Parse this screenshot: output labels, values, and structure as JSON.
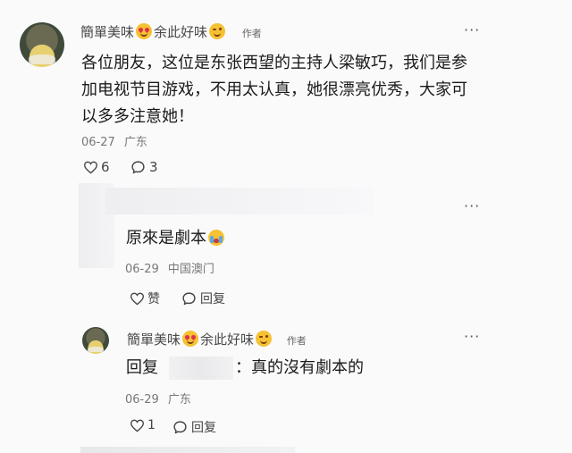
{
  "comment": {
    "username": "簡單美味",
    "username_suffix": "余此好味",
    "author_tag": "作者",
    "more_label": "···",
    "text_line1": "各位朋友，这位是东张西望的主持人梁敏巧，我们是参",
    "text_line2": "加电视节目游戏，不用太认真，她很漂亮优秀，大家可",
    "text_line3": "以多多注意她！",
    "date": "06-27",
    "location": "广东",
    "likes": "6",
    "replies": "3"
  },
  "reply1": {
    "more_label": "···",
    "text": "原來是劇本",
    "date": "06-29",
    "location": "中国澳门",
    "like_label": "赞",
    "reply_label": "回复"
  },
  "reply2": {
    "username": "簡單美味",
    "username_suffix": "余此好味",
    "author_tag": "作者",
    "more_label": "···",
    "reply_prefix": "回复",
    "text": "：真的沒有劇本的",
    "date": "06-29",
    "location": "广东",
    "likes": "1",
    "reply_label": "回复"
  }
}
